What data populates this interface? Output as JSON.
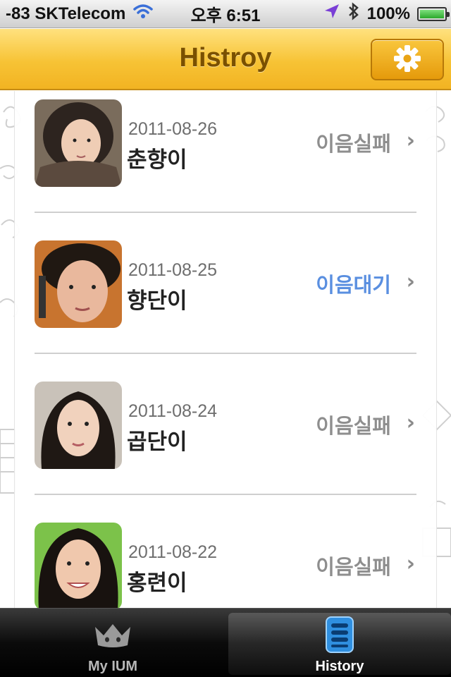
{
  "status_bar": {
    "carrier": "-83 SKTelecom",
    "time": "오후 6:51",
    "battery": "100%",
    "icons": [
      "wifi-icon",
      "location-arrow-icon",
      "bluetooth-icon",
      "battery-icon"
    ]
  },
  "nav": {
    "title": "Histroy",
    "settings_icon": "gear-icon"
  },
  "history": [
    {
      "date": "2011-08-26",
      "name": "춘향이",
      "status": "이음실패",
      "status_type": "failed"
    },
    {
      "date": "2011-08-25",
      "name": "향단이",
      "status": "이음대기",
      "status_type": "pending"
    },
    {
      "date": "2011-08-24",
      "name": "곱단이",
      "status": "이음실패",
      "status_type": "failed"
    },
    {
      "date": "2011-08-22",
      "name": "홍련이",
      "status": "이음실패",
      "status_type": "failed"
    }
  ],
  "tabs": [
    {
      "label": "My IUM",
      "icon": "crown-icon",
      "selected": false
    },
    {
      "label": "History",
      "icon": "list-icon",
      "selected": true
    }
  ],
  "colors": {
    "nav_yellow": "#f7c335",
    "title_brown": "#7a5000",
    "status_failed": "#8e8e8e",
    "status_pending": "#5a8fe0"
  }
}
